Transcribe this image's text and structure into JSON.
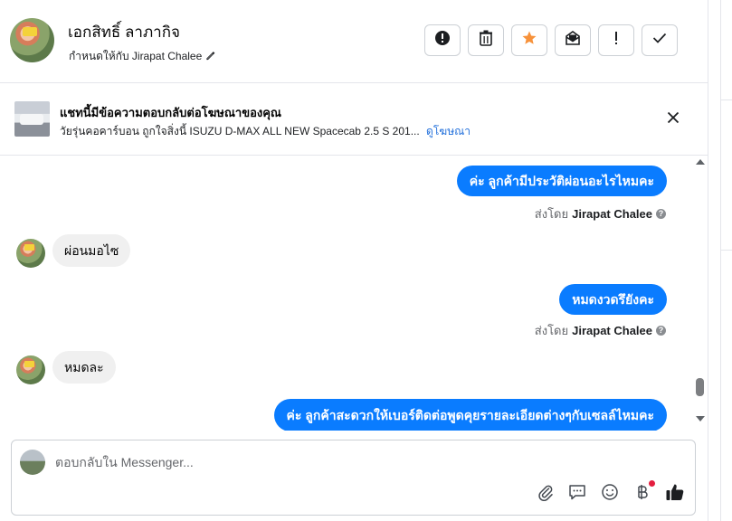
{
  "header": {
    "contact_name": "เอกสิทธิ์ ลาภากิจ",
    "assigned_text": "กำหนดให้กับ Jirapat Chalee",
    "buttons": [
      {
        "name": "spam-button",
        "icon": "alert-circle-icon"
      },
      {
        "name": "delete-button",
        "icon": "trash-icon"
      },
      {
        "name": "star-button",
        "icon": "star-icon"
      },
      {
        "name": "mark-unread-button",
        "icon": "envelope-icon"
      },
      {
        "name": "follow-up-button",
        "icon": "exclamation-icon"
      },
      {
        "name": "mark-done-button",
        "icon": "check-icon"
      }
    ],
    "star_color": "#f7923b"
  },
  "ad": {
    "title": "แชทนี้มีข้อความตอบกลับต่อโฆษณาของคุณ",
    "subtitle": "วัยรุ่นคอคาร์บอน ถูกใจสิ่งนี้ ISUZU D-MAX ALL NEW Spacecab 2.5 S 201...",
    "link": "ดูโฆษณา"
  },
  "messages": [
    {
      "direction": "out",
      "text": "ค่ะ ลูกค้ามีประวัติผ่อนอะไรไหมคะ",
      "sent_by_prefix": "ส่งโดย",
      "sent_by": "Jirapat Chalee"
    },
    {
      "direction": "in",
      "text": "ผ่อนมอไซ"
    },
    {
      "direction": "out",
      "text": "หมดงวดรึยังคะ",
      "sent_by_prefix": "ส่งโดย",
      "sent_by": "Jirapat Chalee"
    },
    {
      "direction": "in",
      "text": "หมดละ"
    },
    {
      "direction": "out",
      "text": "ค่ะ ลูกค้าสะดวกให้เบอร์ติดต่อพูดคุยรายละเอียดต่างๆกับเซลล์ไหมคะ"
    }
  ],
  "composer": {
    "placeholder": "ตอบกลับใน Messenger...",
    "tools": [
      "paperclip-icon",
      "saved-reply-icon",
      "emoji-icon",
      "baht-payment-icon",
      "thumbs-up-icon"
    ]
  },
  "colors": {
    "bubble_out": "#0a7cff",
    "bubble_in": "#f0f0f0",
    "link": "#216fdb"
  }
}
